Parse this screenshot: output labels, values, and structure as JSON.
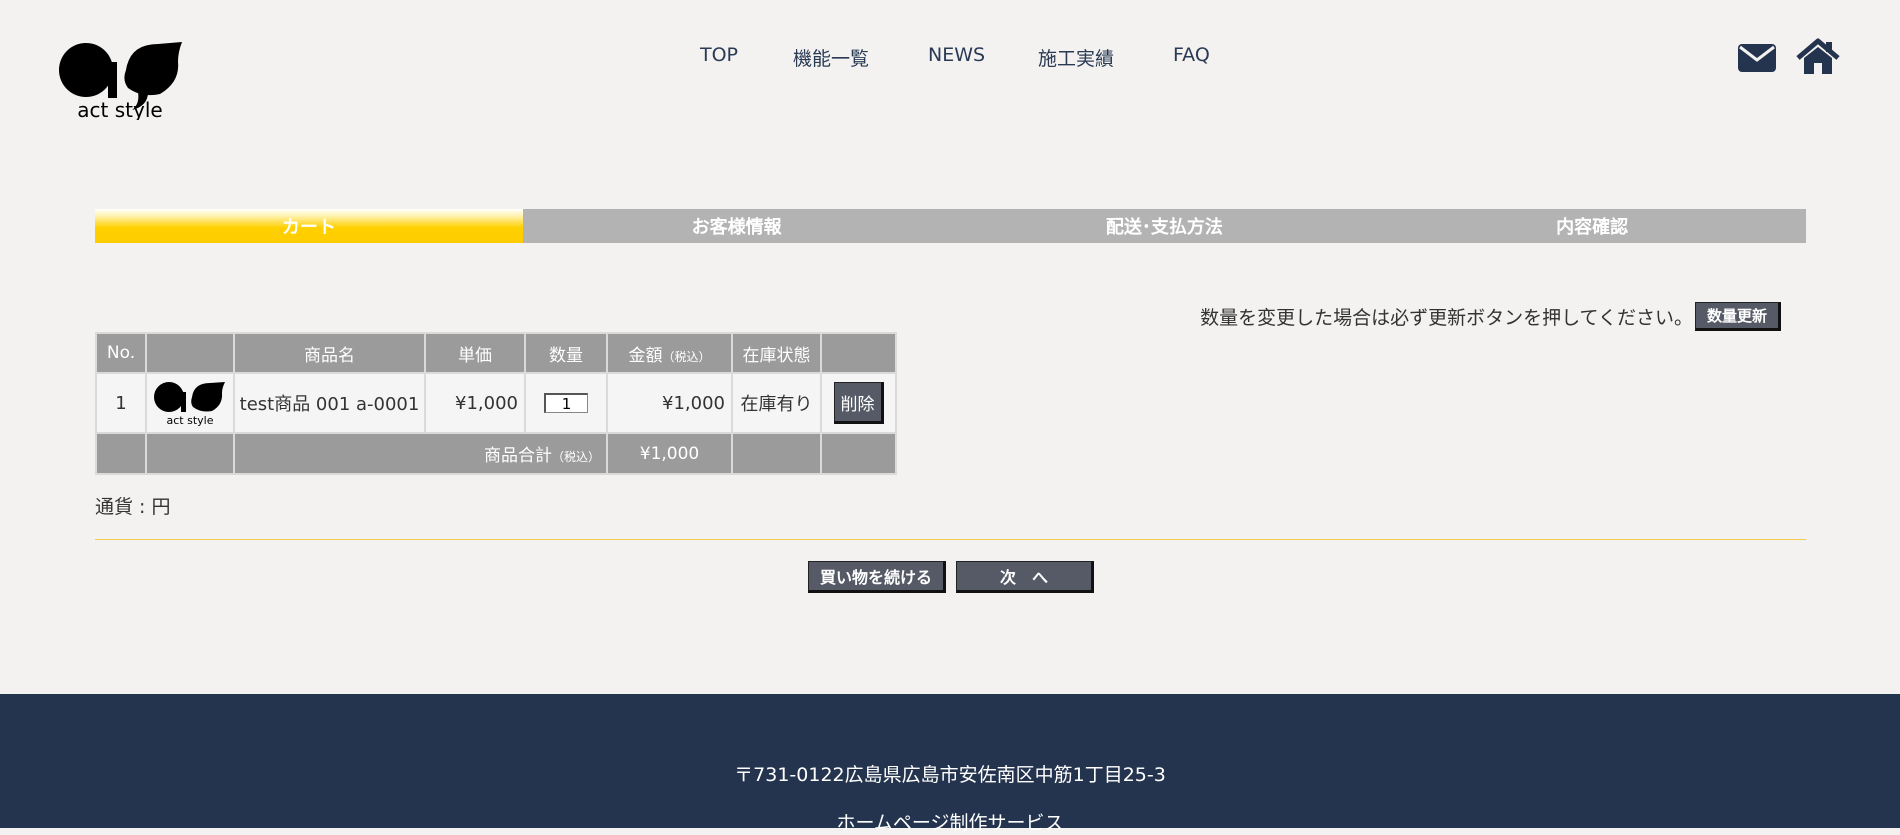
{
  "brand": {
    "logo_text": "act style"
  },
  "nav": [
    {
      "label": "TOP"
    },
    {
      "label": "機能一覧"
    },
    {
      "label": "NEWS"
    },
    {
      "label": "施工実績"
    },
    {
      "label": "FAQ"
    }
  ],
  "header_icons": [
    "mail-icon",
    "home-icon"
  ],
  "steps": [
    {
      "label": "カート",
      "active": true
    },
    {
      "label": "お客様情報",
      "active": false
    },
    {
      "label": "配送･支払方法",
      "active": false
    },
    {
      "label": "内容確認",
      "active": false
    }
  ],
  "update": {
    "notice": "数量を変更した場合は必ず更新ボタンを押してください。",
    "button": "数量更新"
  },
  "cart": {
    "headers": {
      "no": "No.",
      "image": "",
      "name": "商品名",
      "unit_price": "単価",
      "qty": "数量",
      "amount": "金額",
      "amount_note": "（税込）",
      "stock": "在庫状態",
      "action": ""
    },
    "rows": [
      {
        "no": "1",
        "thumb_text": "act style",
        "name": "test商品 001 a-0001",
        "unit_price": "¥1,000",
        "qty": "1",
        "amount": "¥1,000",
        "stock": "在庫有り",
        "delete": "削除"
      }
    ],
    "total": {
      "label": "商品合計",
      "note": "（税込）",
      "amount": "¥1,000"
    }
  },
  "currency": "通貨 : 円",
  "buttons": {
    "continue": "買い物を続ける",
    "next": "次　へ"
  },
  "footer": {
    "address": "〒731-0122広島県広島市安佐南区中筋1丁目25-3",
    "service": "ホームページ制作サービス"
  },
  "colors": {
    "background": "#f3f2f0",
    "accent_yellow": "#ffcc00",
    "step_gray": "#b3b3b3",
    "table_header": "#9b9b9b",
    "button_dark": "#555a66",
    "footer": "#25344e",
    "nav_text": "#2a3a55"
  }
}
